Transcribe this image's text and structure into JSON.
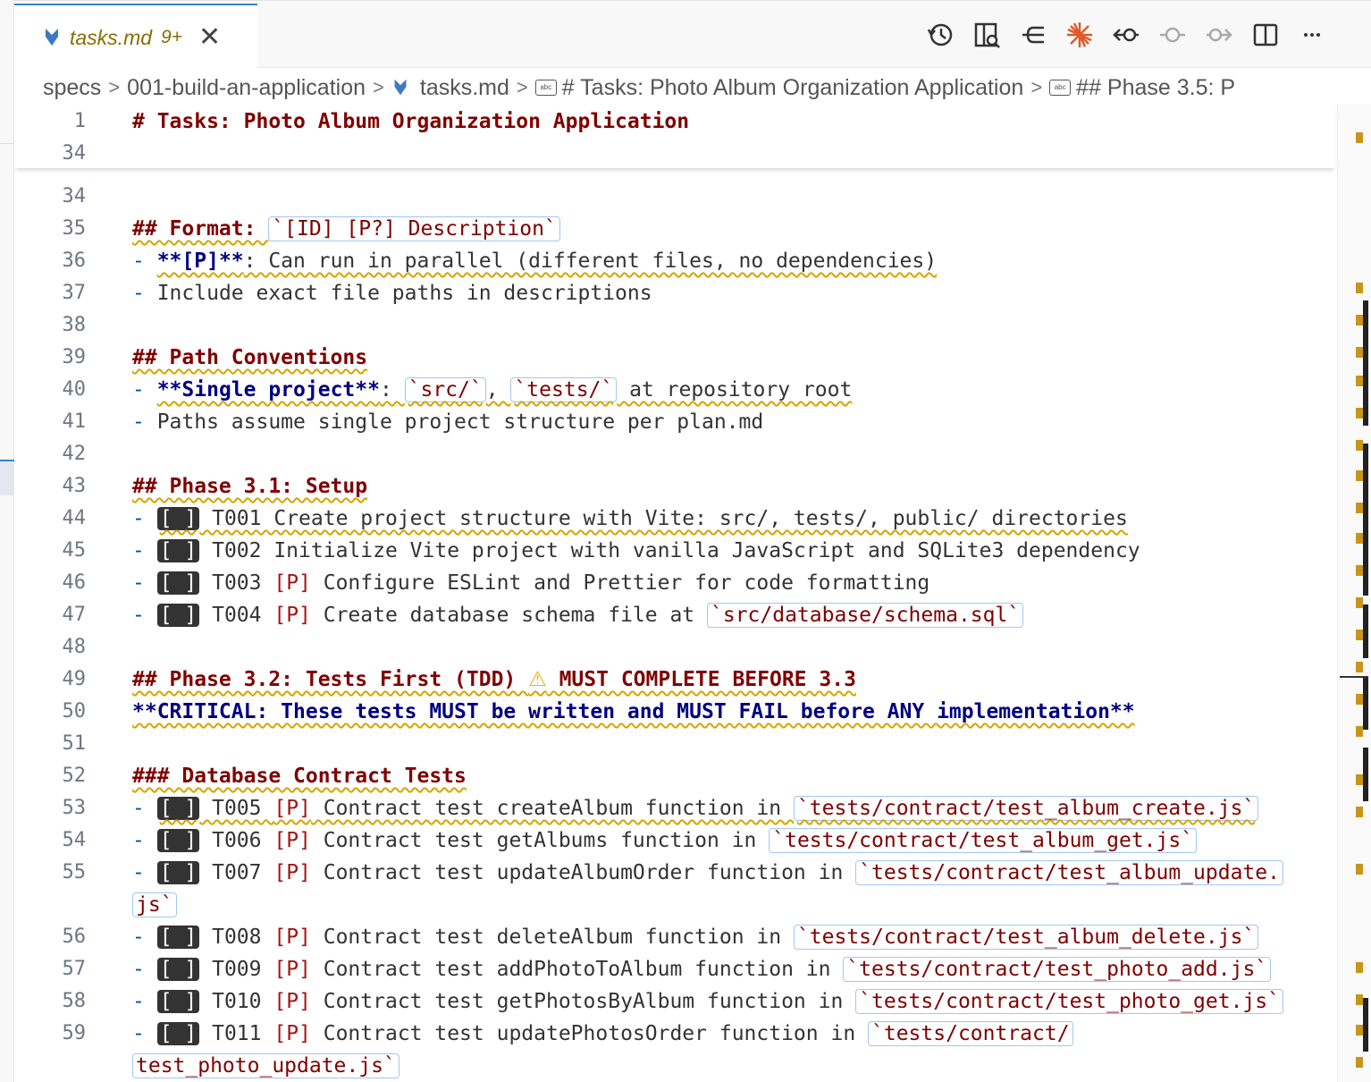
{
  "tab": {
    "title": "tasks.md",
    "count": "9+",
    "close": "✕"
  },
  "toolbar": {
    "actions": [
      "history-icon",
      "open-preview-icon",
      "go-back-icon",
      "copilot-sparkle-icon",
      "go-to-previous-change-icon",
      "current-change-icon",
      "go-to-next-change-icon",
      "split-editor-icon",
      "more-actions-icon"
    ]
  },
  "breadcrumb": {
    "items": [
      "specs",
      "001-build-an-application",
      "tasks.md",
      "# Tasks: Photo Album Organization Application",
      "## Phase 3.5: P"
    ]
  },
  "sticky": {
    "line_no": "1",
    "text": "# Tasks: Photo Album Organization Application",
    "next_no": "34"
  },
  "lines": [
    {
      "n": "34"
    },
    {
      "n": "35",
      "a": "## Format: ",
      "c": "`[ID] [P?] Description`"
    },
    {
      "n": "36",
      "a": "**[P]**",
      "rest": ": Can run in parallel (different files, no dependencies)"
    },
    {
      "n": "37",
      "t": "Include exact file paths in descriptions"
    },
    {
      "n": "38"
    },
    {
      "n": "39",
      "h": "## Path Conventions"
    },
    {
      "n": "40",
      "a": "**Single project**",
      "b1": "src/",
      "b2": "tests/",
      "rest": " at repository root"
    },
    {
      "n": "41",
      "t": "Paths assume single project structure per plan.md"
    },
    {
      "n": "42"
    },
    {
      "n": "43",
      "h": "## Phase 3.1: Setup"
    },
    {
      "n": "44",
      "chk": "[ ]",
      "t": " T001 Create project structure with Vite: src/, tests/, public/ directories"
    },
    {
      "n": "45",
      "chk": "[ ]",
      "t": " T002 Initialize Vite project with vanilla JavaScript and SQLite3 dependency"
    },
    {
      "n": "46",
      "chk": "[ ]",
      "id": " T003 ",
      "p": "[P]",
      "t": " Configure ESLint and Prettier for code formatting"
    },
    {
      "n": "47",
      "chk": "[ ]",
      "id": " T004 ",
      "p": "[P]",
      "t": " Create database schema file at ",
      "c": "`src/database/schema.sql`"
    },
    {
      "n": "48"
    },
    {
      "n": "49",
      "h1": "## Phase 3.2: Tests First (TDD) ",
      "w": "⚠",
      "h2": " MUST COMPLETE BEFORE 3.3"
    },
    {
      "n": "50",
      "bold": "**CRITICAL: These tests MUST be written and MUST FAIL before ANY implementation**"
    },
    {
      "n": "51"
    },
    {
      "n": "52",
      "h": "### Database Contract Tests"
    },
    {
      "n": "53",
      "chk": "[ ]",
      "id": " T005 ",
      "p": "[P]",
      "t": " Contract test createAlbum function in ",
      "c": "`tests/contract/test_album_create.js`"
    },
    {
      "n": "54",
      "chk": "[ ]",
      "id": " T006 ",
      "p": "[P]",
      "t": " Contract test getAlbums function in ",
      "c": "`tests/contract/test_album_get.js`"
    },
    {
      "n": "55",
      "chk": "[ ]",
      "id": " T007 ",
      "p": "[P]",
      "t": " Contract test updateAlbumOrder function in ",
      "c": "`tests/contract/test_album_update.",
      "wrap": "js`"
    },
    {
      "n": "56",
      "chk": "[ ]",
      "id": " T008 ",
      "p": "[P]",
      "t": " Contract test deleteAlbum function in ",
      "c": "`tests/contract/test_album_delete.js`"
    },
    {
      "n": "57",
      "chk": "[ ]",
      "id": " T009 ",
      "p": "[P]",
      "t": " Contract test addPhotoToAlbum function in ",
      "c": "`tests/contract/test_photo_add.js`"
    },
    {
      "n": "58",
      "chk": "[ ]",
      "id": " T010 ",
      "p": "[P]",
      "t": " Contract test getPhotosByAlbum function in ",
      "c": "`tests/contract/test_photo_get.js`"
    },
    {
      "n": "59",
      "chk": "[ ]",
      "id": " T011 ",
      "p": "[P]",
      "t": " Contract test updatePhotosOrder function in ",
      "c": "`tests/contract/",
      "wrap": "test_photo_update.js`"
    }
  ]
}
